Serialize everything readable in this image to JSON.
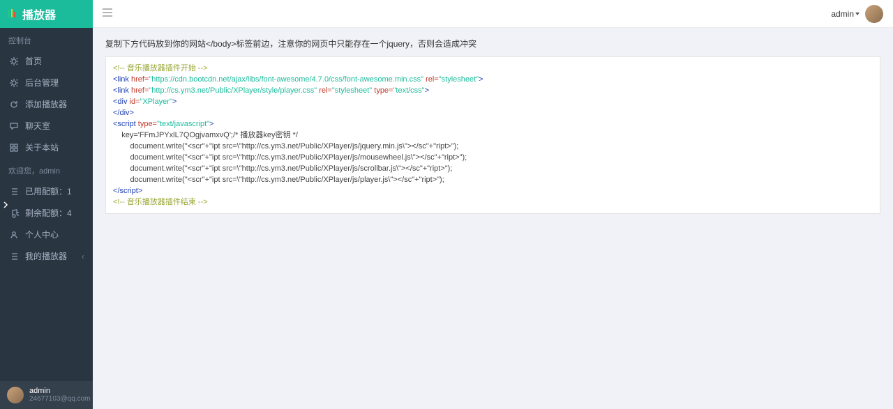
{
  "brand": {
    "title": "播放器"
  },
  "sidebar": {
    "section1": "控制台",
    "items1": [
      {
        "icon": "gear",
        "label": "首页"
      },
      {
        "icon": "gear",
        "label": "后台管理"
      },
      {
        "icon": "refresh",
        "label": "添加播放器"
      },
      {
        "icon": "chat",
        "label": "聊天室"
      },
      {
        "icon": "grid",
        "label": "关于本站"
      }
    ],
    "section2": "欢迎您，admin",
    "items2": [
      {
        "icon": "list",
        "label": "已用配额：1"
      },
      {
        "icon": "music",
        "label": "剩余配额：4"
      },
      {
        "icon": "user",
        "label": "个人中心"
      },
      {
        "icon": "list",
        "label": "我的播放器",
        "chevron": true
      }
    ]
  },
  "footerUser": {
    "name": "admin",
    "email": "24677103@qq.com"
  },
  "header": {
    "adminLabel": "admin"
  },
  "main": {
    "hint": "复制下方代码放到你的网站</body>标签前边，注意你的网页中只能存在一个jquery，否则会造成冲突",
    "code": {
      "l1": "<!-- 音乐播放器插件开始 -->",
      "l2a": "<link ",
      "l2b": "href=",
      "l2c": "\"https://cdn.bootcdn.net/ajax/libs/font-awesome/4.7.0/css/font-awesome.min.css\"",
      "l2d": " rel=",
      "l2e": "\"stylesheet\"",
      "l2f": ">",
      "l3a": "<link ",
      "l3b": "href=",
      "l3c": "\"http://cs.ym3.net/Public/XPlayer/style/player.css\"",
      "l3d": " rel=",
      "l3e": "\"stylesheet\"",
      "l3f": " type=",
      "l3g": "\"text/css\"",
      "l3h": ">",
      "l4a": "<div ",
      "l4b": "id=",
      "l4c": "\"XPlayer\"",
      "l4d": ">",
      "l5": "</div>",
      "l6a": "<script ",
      "l6b": "type=",
      "l6c": "\"text/javascript\"",
      "l6d": ">",
      "l7": "    key='FFmJPYxlL7QOgjvamxvQ';/* 播放器key密钥 */",
      "l8": "        document.write(\"<scr\"+\"ipt src=\\\"http://cs.ym3.net/Public/XPlayer/js/jquery.min.js\\\"></sc\"+\"ript>\");",
      "l9": "        document.write(\"<scr\"+\"ipt src=\\\"http://cs.ym3.net/Public/XPlayer/js/mousewheel.js\\\"></sc\"+\"ript>\");",
      "l10": "        document.write(\"<scr\"+\"ipt src=\\\"http://cs.ym3.net/Public/XPlayer/js/scrollbar.js\\\"></sc\"+\"ript>\");",
      "l11": "        document.write(\"<scr\"+\"ipt src=\\\"http://cs.ym3.net/Public/XPlayer/js/player.js\\\"></sc\"+\"ript>\");",
      "l12a": "<",
      "l12b": "/script>",
      "l13": "<!-- 音乐播放器插件结束 -->"
    }
  }
}
